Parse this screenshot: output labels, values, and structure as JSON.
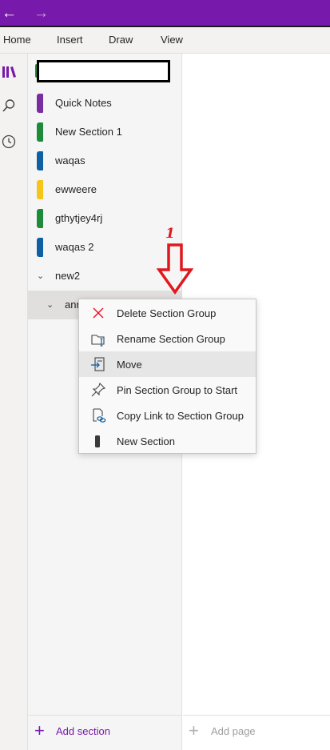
{
  "titlebar": {
    "back_icon": "back-arrow-icon",
    "forward_icon": "forward-arrow-icon",
    "accent": "#7719aa"
  },
  "ribbon": {
    "tabs": [
      "Home",
      "Insert",
      "Draw",
      "View"
    ]
  },
  "icon_rail": {
    "items": [
      "notebooks-icon",
      "search-icon",
      "recent-icon"
    ]
  },
  "notebook": {
    "name": ""
  },
  "sections": [
    {
      "label": "Quick Notes",
      "color": "#7a2da2"
    },
    {
      "label": "New Section 1",
      "color": "#1e8a3b"
    },
    {
      "label": "waqas",
      "color": "#0f5fa3"
    },
    {
      "label": "ewweere",
      "color": "#f5c518"
    },
    {
      "label": "gthytjey4rj",
      "color": "#1e8a3b"
    },
    {
      "label": "waqas 2",
      "color": "#0f5fa3"
    }
  ],
  "section_group": {
    "label": "new2",
    "child_label": "anr"
  },
  "context_menu": {
    "items": [
      {
        "label": "Delete Section Group",
        "icon": "close-icon"
      },
      {
        "label": "Rename Section Group",
        "icon": "rename-icon"
      },
      {
        "label": "Move",
        "icon": "move-icon"
      },
      {
        "label": "Pin Section Group to Start",
        "icon": "pin-icon"
      },
      {
        "label": "Copy Link to Section Group",
        "icon": "link-icon"
      },
      {
        "label": "New Section",
        "icon": "section-icon"
      }
    ],
    "highlighted": "Move"
  },
  "footer": {
    "add_section": "Add section",
    "add_page": "Add page"
  },
  "annotation": {
    "number": "1",
    "color": "#e0181e"
  }
}
